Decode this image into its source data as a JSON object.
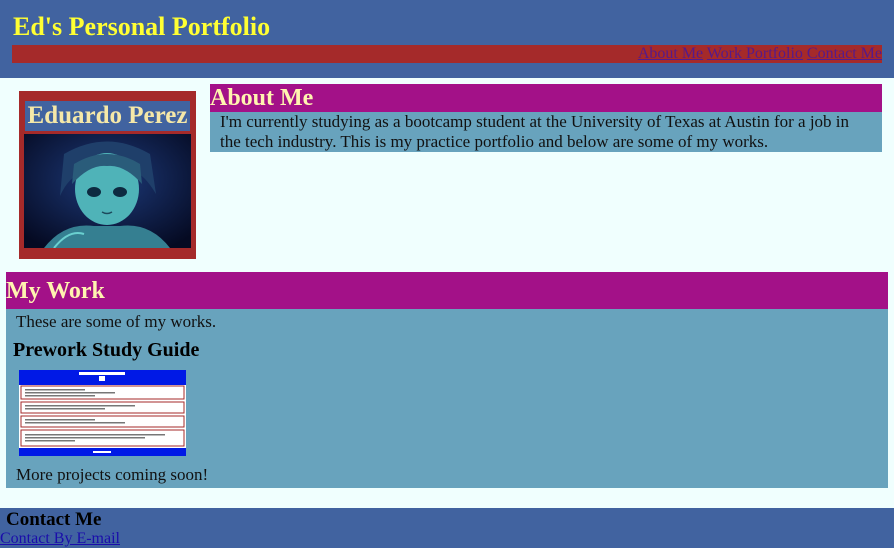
{
  "header": {
    "title": "Ed's Personal Portfolio",
    "nav": [
      "About Me",
      "Work Portfolio",
      "Contact Me"
    ]
  },
  "profile": {
    "name": "Eduardo Perez"
  },
  "about": {
    "heading": "About Me",
    "text": "I'm currently studying as a bootcamp student at the University of Texas at Austin for a job in the tech industry. This is my practice portfolio and below are some of my works."
  },
  "work": {
    "heading": "My Work",
    "intro": "These are some of my works.",
    "project_title": "Prework Study Guide",
    "outro": "More projects coming soon!"
  },
  "footer": {
    "heading": "Contact Me",
    "link": "Contact By E-mail"
  },
  "colors": {
    "header_bg": "#4163a0",
    "nav_bg": "#a52a2a",
    "section_heading_bg": "#a31188",
    "section_body_bg": "#68a3bd",
    "title_color": "#ffff33",
    "page_bg": "#f0fffe"
  }
}
